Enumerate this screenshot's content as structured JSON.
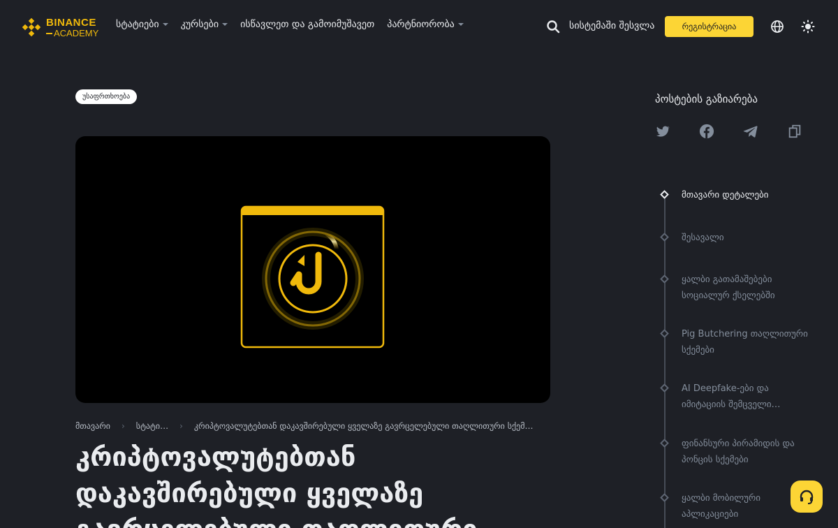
{
  "brand": {
    "line1": "BINANCE",
    "line2": "ACADEMY",
    "color": "#f0b90b"
  },
  "nav": [
    {
      "label": "სტატიები",
      "has_dropdown": true
    },
    {
      "label": "კურსები",
      "has_dropdown": true
    },
    {
      "label": "ისწავლეთ და გამოიმუშავეთ",
      "has_dropdown": false
    },
    {
      "label": "პარტნიორობა",
      "has_dropdown": true
    }
  ],
  "header": {
    "login": "სისტემაში შესვლა",
    "register": "რეგისტრაცია",
    "icons": [
      "search-icon",
      "globe-icon",
      "theme-icon"
    ]
  },
  "article": {
    "tag": "უსაფრთხოება",
    "breadcrumb": [
      "მთავარი",
      "სტატი…",
      "კრიპტოვალუტებთან დაკავშირებული ყველაზე გავრცელებული თაღლითური სქემ…"
    ],
    "title_lines": [
      "კრიპტოვალუტებთან",
      "დაკავშირებული ყველაზე",
      "გავრცელებული თაღლითური"
    ]
  },
  "share": {
    "title": "პოსტების გაზიარება",
    "icons": [
      "twitter-icon",
      "facebook-icon",
      "telegram-icon",
      "copy-icon"
    ]
  },
  "toc": [
    {
      "label": "მთავარი დეტალები",
      "active": true
    },
    {
      "label": "შესავალი",
      "active": false
    },
    {
      "label": "ყალბი გათამაშებები სოციალურ ქსელებში",
      "active": false
    },
    {
      "label": "Pig Butchering თაღლითური სქემები",
      "active": false
    },
    {
      "label": "AI Deepfake-ები და იმიტაციის შემცველი…",
      "active": false
    },
    {
      "label": "ფინანსური პირამიდის და პონცის სქემები",
      "active": false
    },
    {
      "label": "ყალბი მობილური აპლიკაციები",
      "active": false
    }
  ],
  "colors": {
    "background": "#1e2026",
    "accent": "#fcd535",
    "text": "#eaecef",
    "muted": "#848e9c"
  }
}
